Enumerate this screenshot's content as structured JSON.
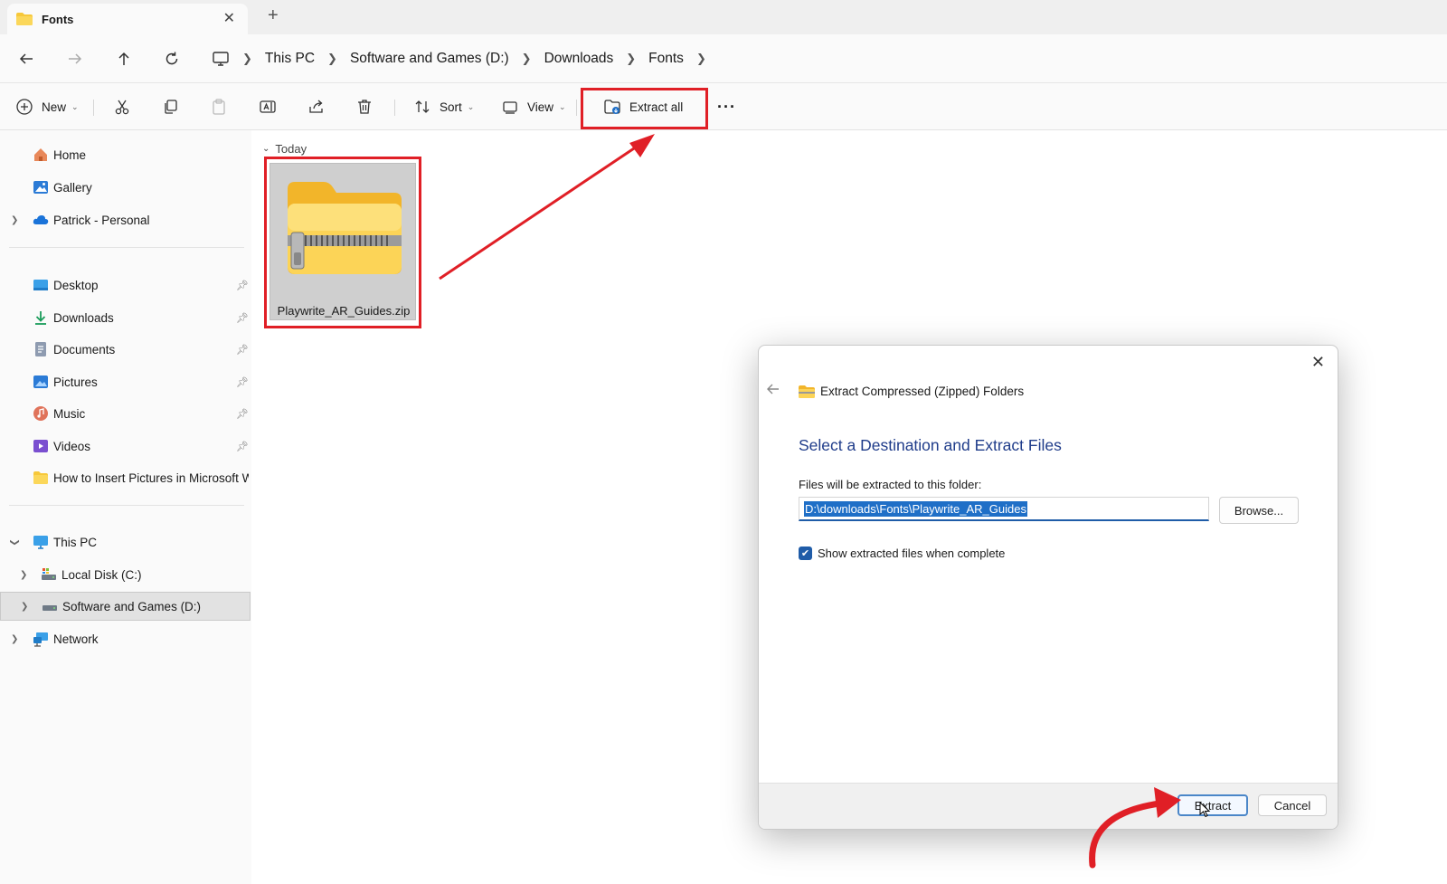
{
  "window": {
    "tab_title": "Fonts",
    "tab_close": "✕",
    "new_tab": "+"
  },
  "address": {
    "crumbs": [
      "This PC",
      "Software and Games (D:)",
      "Downloads",
      "Fonts"
    ]
  },
  "toolbar": {
    "new_label": "New",
    "sort_label": "Sort",
    "view_label": "View",
    "extract_all_label": "Extract all",
    "more_label": "···"
  },
  "sidebar": {
    "home": "Home",
    "gallery": "Gallery",
    "onedrive": "Patrick - Personal",
    "desktop": "Desktop",
    "downloads": "Downloads",
    "documents": "Documents",
    "pictures": "Pictures",
    "music": "Music",
    "videos": "Videos",
    "pinned_folder": "How to Insert Pictures in Microsoft W",
    "this_pc": "This PC",
    "local_disk": "Local Disk (C:)",
    "software_games": "Software and Games (D:)",
    "network": "Network"
  },
  "content": {
    "group_label": "Today",
    "file_name": "Playwrite_AR_Guides.zip"
  },
  "dialog": {
    "title": "Extract Compressed (Zipped) Folders",
    "heading": "Select a Destination and Extract Files",
    "folder_label": "Files will be extracted to this folder:",
    "path_value": "D:\\downloads\\Fonts\\Playwrite_AR_Guides",
    "browse_label": "Browse...",
    "checkbox_label": "Show extracted files when complete",
    "checkbox_checked": true,
    "extract_label": "Extract",
    "cancel_label": "Cancel"
  },
  "colors": {
    "annotation_red": "#e01f26",
    "accent_blue": "#1f5ca8",
    "heading_blue": "#1f3c8a",
    "folder_yellow": "#f7c83a"
  }
}
